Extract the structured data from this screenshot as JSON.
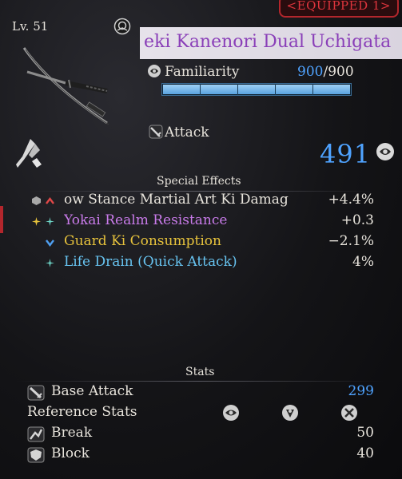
{
  "badge": {
    "equipped": "EQUIPPED 1"
  },
  "weapon": {
    "level": "Lv. 51",
    "name": "eki Kanenori Dual Uchigata",
    "familiarity": {
      "label": "Familiarity",
      "current": "900",
      "separator": "/",
      "max": "900",
      "fill": 1.0
    },
    "attack": {
      "label": "Attack",
      "value": "491"
    }
  },
  "special_effects": {
    "heading": "Special Effects",
    "items": [
      {
        "name": "ow Stance Martial Art Ki Damag",
        "value": "+4.4%",
        "color": "#e8e4dc",
        "icon1": "grey-gem-icon",
        "icon2": "red-chevron-up-icon"
      },
      {
        "name": "Yokai Realm Resistance",
        "value": "+0.3",
        "color": "#c97bea",
        "icon1": "gold-sparkle-icon",
        "icon2": "teal-sparkle-icon"
      },
      {
        "name": "Guard Ki Consumption",
        "value": "−2.1%",
        "color": "#e6c23c",
        "icon1": "",
        "icon2": "blue-chevron-down-icon"
      },
      {
        "name": "Life Drain (Quick Attack)",
        "value": "4%",
        "color": "#67c3f0",
        "icon1": "",
        "icon2": "teal-sparkle-icon"
      }
    ]
  },
  "stats": {
    "heading": "Stats",
    "base_attack": {
      "label": "Base Attack",
      "value": "299",
      "color": "#4fa3ff"
    },
    "reference": {
      "label": "Reference Stats",
      "icons": [
        "heart-stat-icon",
        "skill-stat-icon",
        "dexterity-stat-icon"
      ]
    },
    "break": {
      "label": "Break",
      "value": "50"
    },
    "block": {
      "label": "Block",
      "value": "40"
    }
  },
  "colors": {
    "accent_blue": "#4fa3ff",
    "title_purple": "#8a3fb8",
    "equipped_red": "#e0353d"
  }
}
